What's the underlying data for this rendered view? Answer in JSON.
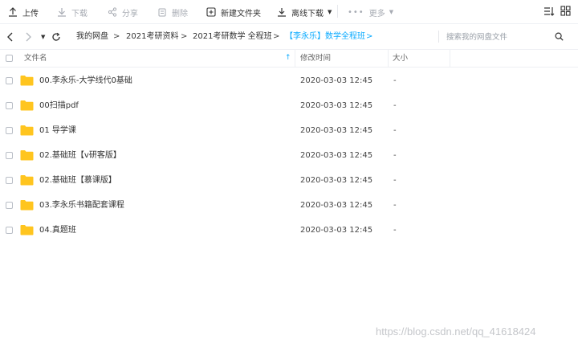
{
  "toolbar": {
    "upload_label": "上传",
    "download_label": "下载",
    "share_label": "分享",
    "delete_label": "删除",
    "new_folder_label": "新建文件夹",
    "offline_download_label": "离线下载",
    "more_label": "更多"
  },
  "breadcrumb": {
    "items": [
      "我的网盘",
      "2021考研资料",
      "2021考研数学 全程班",
      "【李永乐】数学全程班"
    ],
    "separator": ">"
  },
  "search": {
    "placeholder": "搜索我的网盘文件"
  },
  "table": {
    "headers": {
      "name": "文件名",
      "modified": "修改时间",
      "size": "大小"
    },
    "rows": [
      {
        "name": "00.李永乐-大学线代0基础",
        "modified": "2020-03-03 12:45",
        "size": "-"
      },
      {
        "name": "00扫描pdf",
        "modified": "2020-03-03 12:45",
        "size": "-"
      },
      {
        "name": "01 导学课",
        "modified": "2020-03-03 12:45",
        "size": "-"
      },
      {
        "name": "02.基础班【v研客版】",
        "modified": "2020-03-03 12:45",
        "size": "-"
      },
      {
        "name": "02.基础班【慕课版】",
        "modified": "2020-03-03 12:45",
        "size": "-"
      },
      {
        "name": "03.李永乐书籍配套课程",
        "modified": "2020-03-03 12:45",
        "size": "-"
      },
      {
        "name": "04.真题班",
        "modified": "2020-03-03 12:45",
        "size": "-"
      }
    ]
  },
  "watermark": "https://blog.csdn.net/qq_41618424",
  "colors": {
    "accent": "#09aaff",
    "folder": "#ffc51f",
    "disabled": "#a7abb3"
  },
  "icons": [
    "upload-icon",
    "download-icon",
    "share-icon",
    "delete-icon",
    "new-folder-icon",
    "offline-download-icon",
    "more-icon",
    "sort-icon",
    "grid-view-icon",
    "back-icon",
    "forward-icon",
    "history-dropdown-icon",
    "refresh-icon",
    "search-icon",
    "folder-icon"
  ]
}
